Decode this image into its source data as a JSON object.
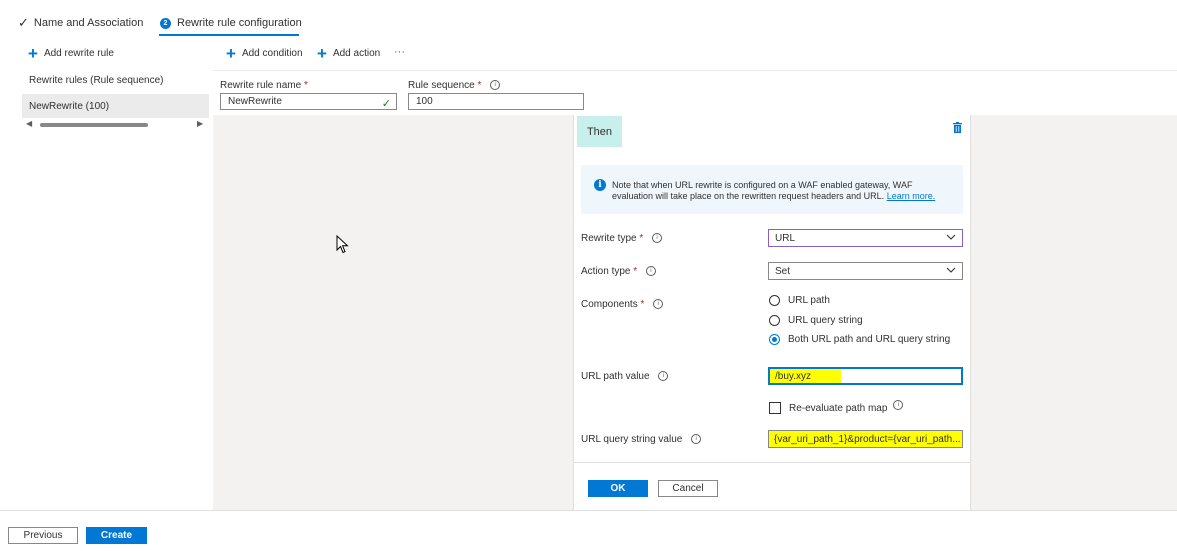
{
  "tabs": [
    {
      "label": "Name and Association",
      "state": "completed"
    },
    {
      "label": "Rewrite rule configuration",
      "step": "2",
      "state": "active"
    }
  ],
  "left_pane": {
    "add_rewrite_rule": "Add rewrite rule",
    "list_header": "Rewrite rules (Rule sequence)",
    "items": [
      {
        "label": "NewRewrite (100)"
      }
    ]
  },
  "toolbar": {
    "add_condition": "Add condition",
    "add_action": "Add action",
    "more": "···"
  },
  "rule": {
    "name_label": "Rewrite rule name",
    "name_value": "NewRewrite",
    "sequence_label": "Rule sequence",
    "sequence_value": "100",
    "required_mark": "*"
  },
  "then_panel": {
    "header": "Then",
    "note_text": "Note that when URL rewrite is configured on a WAF enabled gateway, WAF evaluation will take place on the rewritten request headers and URL.",
    "note_link": "Learn more.",
    "rewrite_type_label": "Rewrite type",
    "rewrite_type_value": "URL",
    "action_type_label": "Action type",
    "action_type_value": "Set",
    "components_label": "Components",
    "components_options": [
      {
        "label": "URL path",
        "selected": false
      },
      {
        "label": "URL query string",
        "selected": false
      },
      {
        "label": "Both URL path and URL query string",
        "selected": true
      }
    ],
    "url_path_label": "URL path value",
    "url_path_value": "/buy.xyz",
    "reevaluate_label": "Re-evaluate path map",
    "reevaluate_checked": false,
    "query_string_label": "URL query string value",
    "query_string_value": "{var_uri_path_1}&product={var_uri_path...",
    "ok": "OK",
    "cancel": "Cancel"
  },
  "footer": {
    "previous": "Previous",
    "create": "Create"
  },
  "colors": {
    "accent": "#0078d4",
    "then_bg": "#c7f0ec",
    "highlight": "#ffff00",
    "required": "#a4262c"
  },
  "icons": [
    "checkmark-icon",
    "plus-icon",
    "info-icon",
    "trash-icon",
    "chevron-down-icon",
    "mouse-cursor-icon"
  ]
}
